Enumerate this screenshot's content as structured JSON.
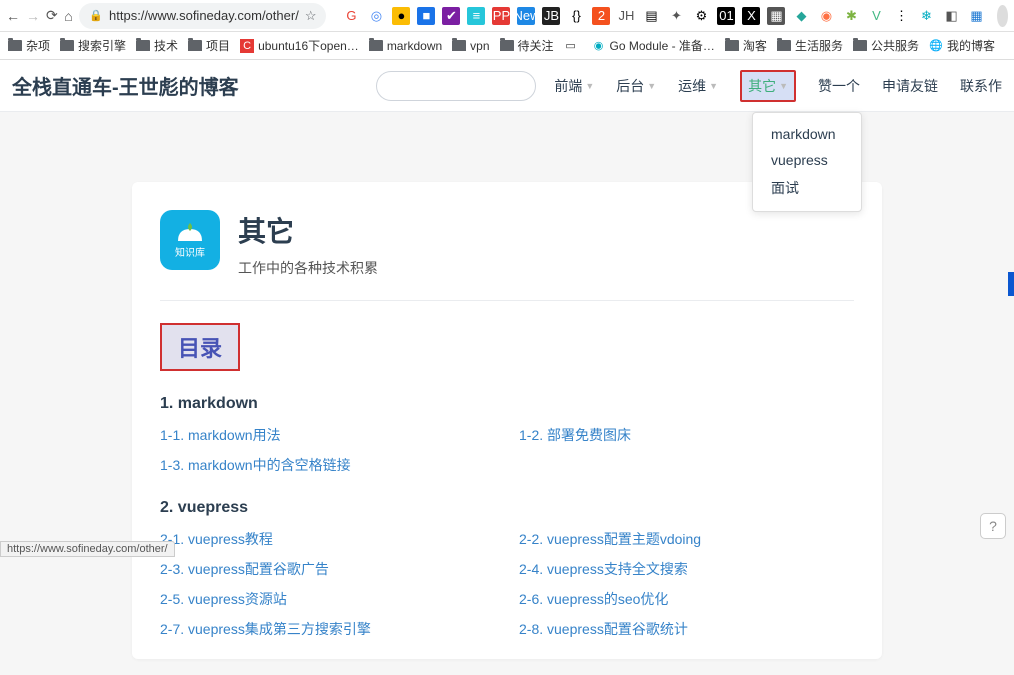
{
  "browser": {
    "url": "https://www.sofineday.com/other/",
    "status_url": "https://www.sofineday.com/other/"
  },
  "ext_icons": [
    {
      "bg": "#fff",
      "fg": "#ea4335",
      "t": "G"
    },
    {
      "bg": "#fff",
      "fg": "#4285f4",
      "t": "◎"
    },
    {
      "bg": "#fbbc04",
      "fg": "#000",
      "t": "●"
    },
    {
      "bg": "#1a73e8",
      "fg": "#fff",
      "t": "■"
    },
    {
      "bg": "#7b1fa2",
      "fg": "#fff",
      "t": "✔"
    },
    {
      "bg": "#26c6da",
      "fg": "#fff",
      "t": "≡"
    },
    {
      "bg": "#e53935",
      "fg": "#fff",
      "t": "PP"
    },
    {
      "bg": "#1e88e5",
      "fg": "#fff",
      "t": "New"
    },
    {
      "bg": "#212121",
      "fg": "#fff",
      "t": "JB"
    },
    {
      "bg": "#fff",
      "fg": "#000",
      "t": "{}"
    },
    {
      "bg": "#f4511e",
      "fg": "#fff",
      "t": "2"
    },
    {
      "bg": "#fff",
      "fg": "#555",
      "t": "JH"
    },
    {
      "bg": "#fff",
      "fg": "#000",
      "t": "▤"
    },
    {
      "bg": "#fff",
      "fg": "#555",
      "t": "✦"
    },
    {
      "bg": "#fff",
      "fg": "#000",
      "t": "⚙"
    },
    {
      "bg": "#000",
      "fg": "#fff",
      "t": "01"
    },
    {
      "bg": "#000",
      "fg": "#fff",
      "t": "X"
    },
    {
      "bg": "#555",
      "fg": "#fff",
      "t": "▦"
    },
    {
      "bg": "#fff",
      "fg": "#26a69a",
      "t": "◆"
    },
    {
      "bg": "#fff",
      "fg": "#ff7043",
      "t": "◉"
    },
    {
      "bg": "#fff",
      "fg": "#7cb342",
      "t": "✱"
    },
    {
      "bg": "#fff",
      "fg": "#42b883",
      "t": "V"
    },
    {
      "bg": "#fff",
      "fg": "#000",
      "t": "⋮"
    },
    {
      "bg": "#fff",
      "fg": "#00acc1",
      "t": "❄"
    },
    {
      "bg": "#fff",
      "fg": "#555",
      "t": "◧"
    },
    {
      "bg": "#fff",
      "fg": "#1976d2",
      "t": "▦"
    }
  ],
  "bookmarks": [
    {
      "icon": "folder",
      "label": "杂项"
    },
    {
      "icon": "folder",
      "label": "搜索引擎"
    },
    {
      "icon": "folder",
      "label": "技术"
    },
    {
      "icon": "folder",
      "label": "项目"
    },
    {
      "icon": "red",
      "label": "ubuntu16下open…"
    },
    {
      "icon": "folder",
      "label": "markdown"
    },
    {
      "icon": "folder",
      "label": "vpn"
    },
    {
      "icon": "folder",
      "label": "待关注"
    },
    {
      "icon": "doc",
      "label": ""
    },
    {
      "icon": "go",
      "label": "Go Module - 准备…"
    },
    {
      "icon": "folder",
      "label": "淘客"
    },
    {
      "icon": "folder",
      "label": "生活服务"
    },
    {
      "icon": "folder",
      "label": "公共服务"
    },
    {
      "icon": "globe",
      "label": "我的博客"
    }
  ],
  "site": {
    "title": "全栈直通车-王世彪的博客",
    "nav": [
      {
        "label": "前端",
        "caret": true
      },
      {
        "label": "后台",
        "caret": true
      },
      {
        "label": "运维",
        "caret": true
      },
      {
        "label": "其它",
        "caret": true,
        "active": true
      },
      {
        "label": "赞一个"
      },
      {
        "label": "申请友链"
      },
      {
        "label": "联系作"
      }
    ],
    "dropdown": [
      "markdown",
      "vuepress",
      "面试"
    ]
  },
  "page": {
    "icon_label": "知识库",
    "title": "其它",
    "subtitle": "工作中的各种技术积累",
    "toc_label": "目录",
    "sections": [
      {
        "heading": "1. markdown",
        "links": [
          "1-1. markdown用法",
          "1-2. 部署免费图床",
          "1-3. markdown中的含空格链接"
        ]
      },
      {
        "heading": "2. vuepress",
        "links": [
          "2-1. vuepress教程",
          "2-2. vuepress配置主题vdoing",
          "2-3. vuepress配置谷歌广告",
          "2-4. vuepress支持全文搜索",
          "2-5. vuepress资源站",
          "2-6. vuepress的seo优化",
          "2-7. vuepress集成第三方搜索引擎",
          "2-8. vuepress配置谷歌统计"
        ]
      }
    ]
  }
}
